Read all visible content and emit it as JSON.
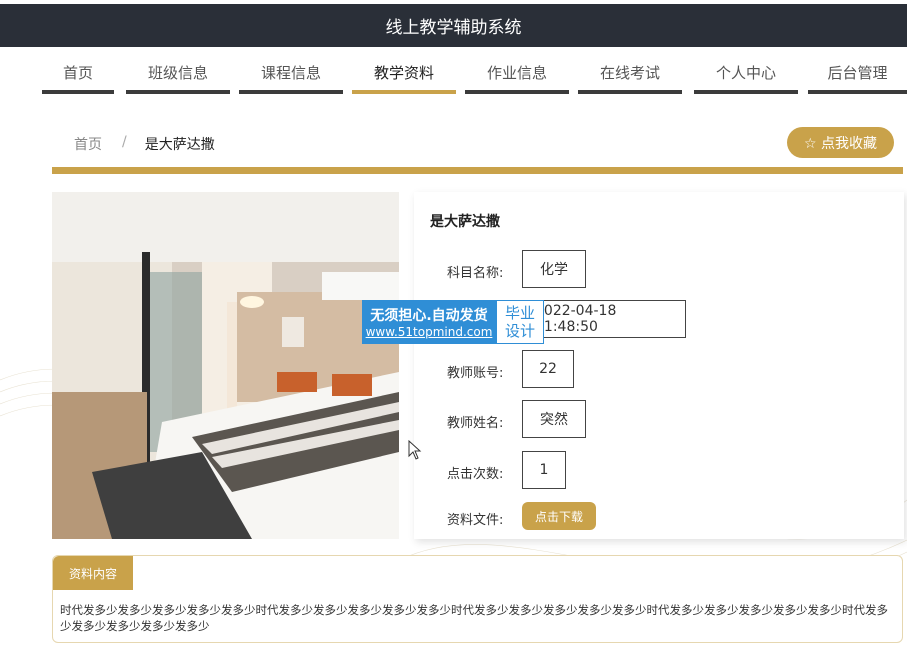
{
  "app": {
    "title": "线上教学辅助系统"
  },
  "nav": {
    "items": [
      {
        "label": "首页"
      },
      {
        "label": "班级信息"
      },
      {
        "label": "课程信息"
      },
      {
        "label": "教学资料",
        "active": true
      },
      {
        "label": "作业信息"
      },
      {
        "label": "在线考试"
      },
      {
        "label": "个人中心"
      },
      {
        "label": "后台管理"
      }
    ]
  },
  "breadcrumb": {
    "home": "首页",
    "separator": "/",
    "current": "是大萨达撒"
  },
  "favorite_button": {
    "icon": "star-outline-icon",
    "label": "☆ 点我收藏"
  },
  "detail": {
    "title": "是大萨达撒",
    "fields": [
      {
        "label": "科目名称:",
        "value": "化学"
      },
      {
        "label": "",
        "value": "2022-04-18 11:48:50"
      },
      {
        "label": "教师账号:",
        "value": "22"
      },
      {
        "label": "教师姓名:",
        "value": "突然"
      },
      {
        "label": "点击次数:",
        "value": "1"
      }
    ],
    "file_label": "资料文件:",
    "download_label": "点击下载"
  },
  "watermark": {
    "line1": "无须担心.自动发货",
    "line2": "www.51topmind.com",
    "badge_line1": "毕业",
    "badge_line2": "设计"
  },
  "content": {
    "tab_label": "资料内容",
    "text": "时代发多少发多少发多少发多少发多少时代发多少发多少发多少发多少发多少时代发多少发多少发多少发多少发多少时代发多少发多少发多少发多少发多少时代发多少发多少发多少发多少发多少"
  },
  "colors": {
    "accent": "#c9a24a",
    "header_bg": "#2a2f38",
    "nav_bar": "#3b3b3b"
  }
}
